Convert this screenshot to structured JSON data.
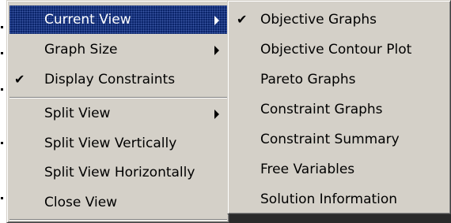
{
  "main_menu": {
    "items": [
      {
        "label": "Current View",
        "checked": false,
        "has_submenu": true,
        "highlighted": true
      },
      {
        "label": "Graph Size",
        "checked": false,
        "has_submenu": true
      },
      {
        "label": "Display Constraints",
        "checked": true,
        "has_submenu": false
      },
      {
        "label": "Split View",
        "checked": false,
        "has_submenu": true
      },
      {
        "label": "Split View Vertically",
        "checked": false,
        "has_submenu": false
      },
      {
        "label": "Split View Horizontally",
        "checked": false,
        "has_submenu": false
      },
      {
        "label": "Close View",
        "checked": false,
        "has_submenu": false
      }
    ]
  },
  "submenu": {
    "items": [
      {
        "label": "Objective Graphs",
        "checked": true
      },
      {
        "label": "Objective Contour Plot",
        "checked": false
      },
      {
        "label": "Pareto Graphs",
        "checked": false
      },
      {
        "label": "Constraint Graphs",
        "checked": false
      },
      {
        "label": "Constraint Summary",
        "checked": false
      },
      {
        "label": "Free Variables",
        "checked": false
      },
      {
        "label": "Solution Information",
        "checked": false
      }
    ]
  },
  "glyphs": {
    "check": "✔"
  },
  "colors": {
    "menu_background": "#d4d0c8",
    "highlight": "#0a246a",
    "highlight_text": "#ffffff"
  }
}
